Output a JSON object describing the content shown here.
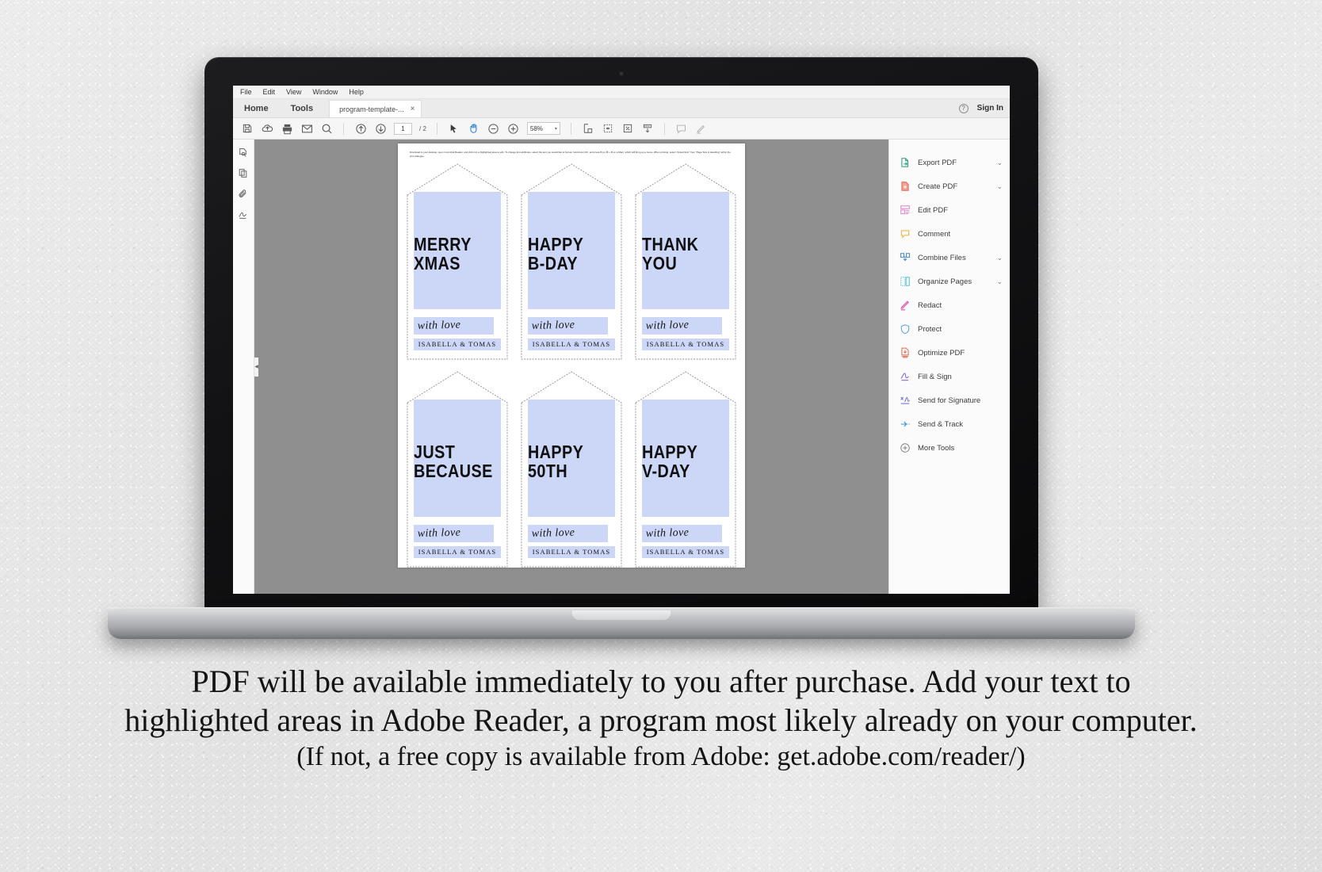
{
  "app": {
    "menubar": [
      "File",
      "Edit",
      "View",
      "Window",
      "Help"
    ],
    "nav_tabs": [
      "Home",
      "Tools"
    ],
    "document_tab": {
      "label": "program-template-...",
      "close": "×"
    },
    "help_glyph": "?",
    "sign_in": "Sign In"
  },
  "toolbar": {
    "page_current": "1",
    "page_total": "/ 2",
    "zoom_level": "58%",
    "zoom_caret": "▾",
    "icons": [
      "save-icon",
      "upload-cloud-icon",
      "print-icon",
      "email-icon",
      "search-icon",
      "previous-page-icon",
      "next-page-icon",
      "select-cursor-icon",
      "hand-tool-icon",
      "zoom-out-icon",
      "zoom-in-icon",
      "fit-page-icon",
      "fit-width-icon",
      "full-screen-icon",
      "scroll-mode-icon",
      "comment-icon",
      "highlight-icon"
    ]
  },
  "left_rail": {
    "icons": [
      "page-thumbnails-icon",
      "pages-panel-icon",
      "attachments-icon",
      "signatures-icon"
    ]
  },
  "canvas": {
    "collapse_handle": "◀"
  },
  "pdf": {
    "instructions": "Download to your desktop, open in Acrobat Reader, and click into a highlighted area to edit. To change font attributes, select the text you would like to format, hold down Ctrl, and press B (or ⌘ + B on a Mac), which will bring up a menu.  When printing, select \"Actual Size\" from \"Page Size & Handling\" within the print dialogue.",
    "tags": [
      {
        "title": "MERRY\nXMAS",
        "love": "with love",
        "names": "ISABELLA & TOMAS"
      },
      {
        "title": "HAPPY\nB-DAY",
        "love": "with love",
        "names": "ISABELLA & TOMAS"
      },
      {
        "title": "THANK\nYOU",
        "love": "with love",
        "names": "ISABELLA & TOMAS"
      },
      {
        "title": "JUST\nBECAUSE",
        "love": "with love",
        "names": "ISABELLA & TOMAS"
      },
      {
        "title": "HAPPY\n50TH",
        "love": "with love",
        "names": "ISABELLA & TOMAS"
      },
      {
        "title": "HAPPY\nV-DAY",
        "love": "with love",
        "names": "ISABELLA & TOMAS"
      }
    ],
    "highlight_color": "#ccd6f7"
  },
  "tools_panel": {
    "items": [
      {
        "label": "Export PDF",
        "icon": "export-pdf-icon",
        "caret": "⌄",
        "has_caret": true
      },
      {
        "label": "Create PDF",
        "icon": "create-pdf-icon",
        "caret": "⌄",
        "has_caret": true
      },
      {
        "label": "Edit PDF",
        "icon": "edit-pdf-icon",
        "caret": "",
        "has_caret": false
      },
      {
        "label": "Comment",
        "icon": "comment-icon",
        "caret": "",
        "has_caret": false
      },
      {
        "label": "Combine Files",
        "icon": "combine-files-icon",
        "caret": "⌄",
        "has_caret": true
      },
      {
        "label": "Organize Pages",
        "icon": "organize-pages-icon",
        "caret": "⌄",
        "has_caret": true
      },
      {
        "label": "Redact",
        "icon": "redact-icon",
        "caret": "",
        "has_caret": false
      },
      {
        "label": "Protect",
        "icon": "protect-icon",
        "caret": "",
        "has_caret": false
      },
      {
        "label": "Optimize PDF",
        "icon": "optimize-pdf-icon",
        "caret": "",
        "has_caret": false
      },
      {
        "label": "Fill & Sign",
        "icon": "fill-and-sign-icon",
        "caret": "",
        "has_caret": false
      },
      {
        "label": "Send for Signature",
        "icon": "send-for-signature-icon",
        "caret": "",
        "has_caret": false
      },
      {
        "label": "Send & Track",
        "icon": "send-and-track-icon",
        "caret": "",
        "has_caret": false
      },
      {
        "label": "More Tools",
        "icon": "more-tools-icon",
        "caret": "",
        "has_caret": false
      }
    ],
    "colors": {
      "export": "#4aa98a",
      "create": "#ea7a68",
      "edit": "#e48fd0",
      "comment": "#f0b94a",
      "combine": "#4c8fd6",
      "organize": "#5fc5d8",
      "redact": "#e25fb0",
      "protect": "#6aa9e0",
      "optimize": "#e06a52",
      "fill": "#8270e0",
      "signature": "#6f6fd6",
      "track": "#3a9ad9",
      "more": "#7a7a7a"
    }
  },
  "caption": {
    "line1": "PDF will be available immediately to you after purchase.  Add your text to",
    "line2": "highlighted areas in Adobe Reader, a program most likely already on your computer.",
    "line3": "(If not, a free copy is available from Adobe: get.adobe.com/reader/)"
  }
}
